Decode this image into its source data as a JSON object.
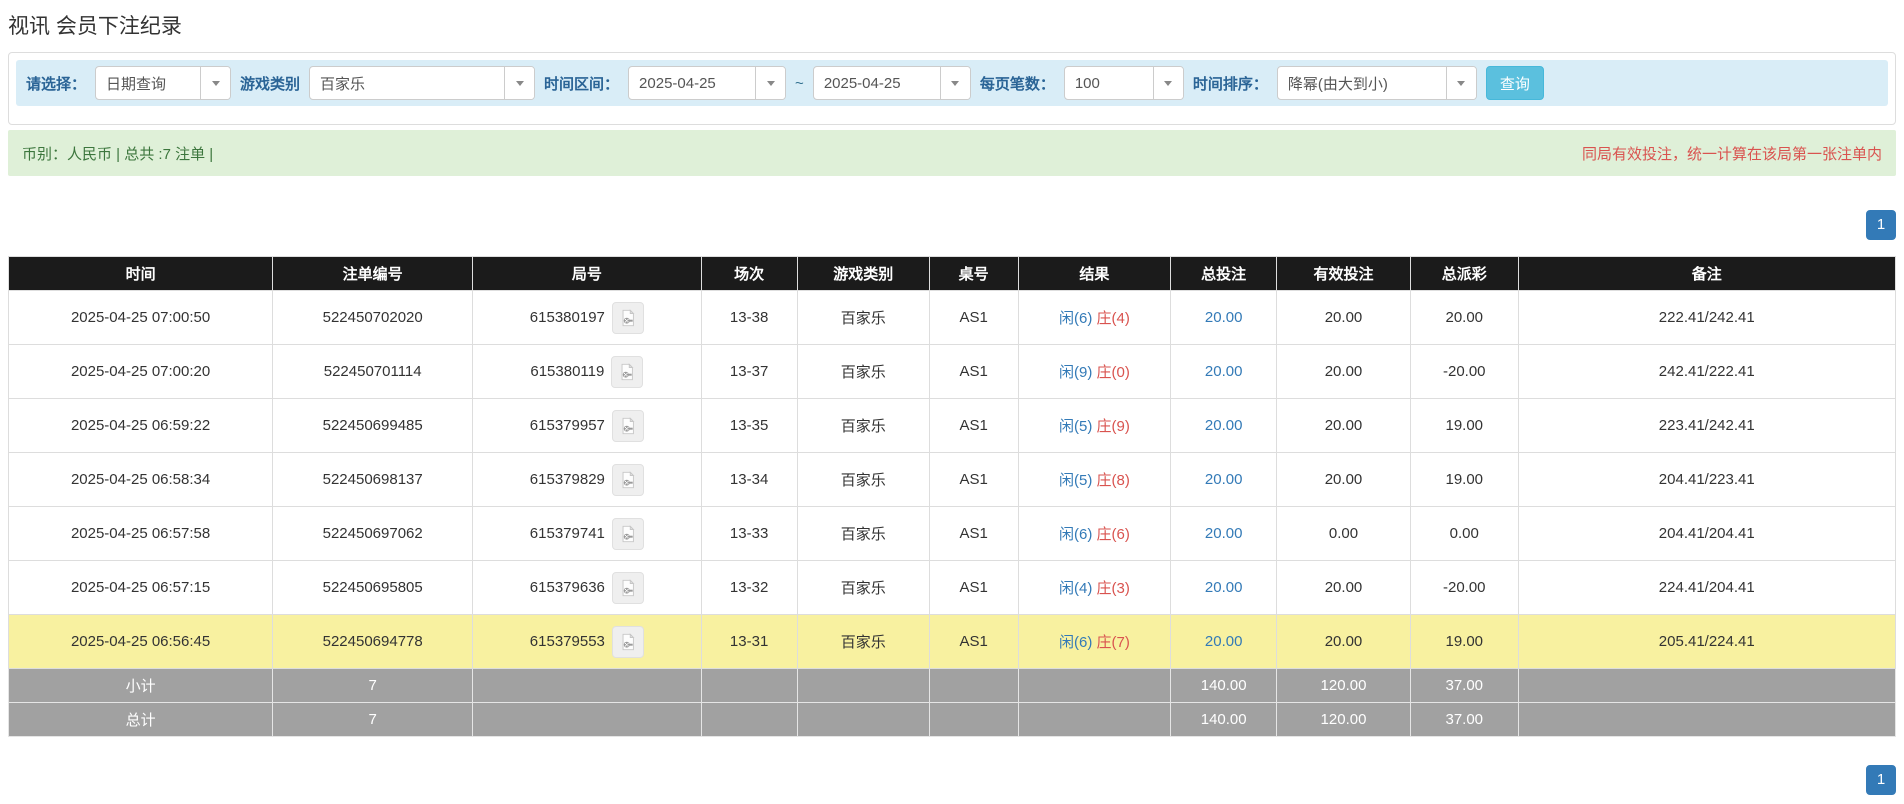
{
  "page_title": "视讯 会员下注纪录",
  "filters": {
    "select_label": "请选择：",
    "select_value": "日期查询",
    "game_type_label": "游戏类别",
    "game_type_value": "百家乐",
    "time_range_label": "时间区间：",
    "date_from": "2025-04-25",
    "tilde": "~",
    "date_to": "2025-04-25",
    "page_size_label": "每页笔数：",
    "page_size_value": "100",
    "sort_label": "时间排序：",
    "sort_value": "降幂(由大到小)",
    "search_button": "查询"
  },
  "summary": {
    "left_text": "币别：人民币 | 总共 :7 注单 |",
    "right_note": "同局有效投注，统一计算在该局第一张注单内"
  },
  "pagination": {
    "page": "1"
  },
  "colors": {
    "accent_blue": "#337ab7",
    "player_blue": "#337ab7",
    "banker_red": "#d9534f",
    "negative_red": "#ff0000",
    "highlight_yellow": "#f8f1a0",
    "filter_bar_bg": "#d9edf7",
    "summary_bar_bg": "#dff0d8",
    "header_bg": "#1b1b1b",
    "totals_bg": "#a1a1a1",
    "search_button_bg": "#5bc0de"
  },
  "table": {
    "headers": [
      "时间",
      "注单编号",
      "局号",
      "场次",
      "游戏类别",
      "桌号",
      "结果",
      "总投注",
      "有效投注",
      "总派彩",
      "备注"
    ],
    "rows": [
      {
        "time": "2025-04-25 07:00:50",
        "bet_id": "522450702020",
        "round_id": "615380197",
        "session": "13-38",
        "game": "百家乐",
        "table_no": "AS1",
        "result_player": "闲(6)",
        "result_banker": "庄(4)",
        "total_bet": "20.00",
        "valid_bet": "20.00",
        "payout": "20.00",
        "payout_negative": false,
        "remark": "222.41/242.41",
        "highlight": false
      },
      {
        "time": "2025-04-25 07:00:20",
        "bet_id": "522450701114",
        "round_id": "615380119",
        "session": "13-37",
        "game": "百家乐",
        "table_no": "AS1",
        "result_player": "闲(9)",
        "result_banker": "庄(0)",
        "total_bet": "20.00",
        "valid_bet": "20.00",
        "payout": "-20.00",
        "payout_negative": true,
        "remark": "242.41/222.41",
        "highlight": false
      },
      {
        "time": "2025-04-25 06:59:22",
        "bet_id": "522450699485",
        "round_id": "615379957",
        "session": "13-35",
        "game": "百家乐",
        "table_no": "AS1",
        "result_player": "闲(5)",
        "result_banker": "庄(9)",
        "total_bet": "20.00",
        "valid_bet": "20.00",
        "payout": "19.00",
        "payout_negative": false,
        "remark": "223.41/242.41",
        "highlight": false
      },
      {
        "time": "2025-04-25 06:58:34",
        "bet_id": "522450698137",
        "round_id": "615379829",
        "session": "13-34",
        "game": "百家乐",
        "table_no": "AS1",
        "result_player": "闲(5)",
        "result_banker": "庄(8)",
        "total_bet": "20.00",
        "valid_bet": "20.00",
        "payout": "19.00",
        "payout_negative": false,
        "remark": "204.41/223.41",
        "highlight": false
      },
      {
        "time": "2025-04-25 06:57:58",
        "bet_id": "522450697062",
        "round_id": "615379741",
        "session": "13-33",
        "game": "百家乐",
        "table_no": "AS1",
        "result_player": "闲(6)",
        "result_banker": "庄(6)",
        "total_bet": "20.00",
        "valid_bet": "0.00",
        "payout": "0.00",
        "payout_negative": false,
        "remark": "204.41/204.41",
        "highlight": false
      },
      {
        "time": "2025-04-25 06:57:15",
        "bet_id": "522450695805",
        "round_id": "615379636",
        "session": "13-32",
        "game": "百家乐",
        "table_no": "AS1",
        "result_player": "闲(4)",
        "result_banker": "庄(3)",
        "total_bet": "20.00",
        "valid_bet": "20.00",
        "payout": "-20.00",
        "payout_negative": true,
        "remark": "224.41/204.41",
        "highlight": false
      },
      {
        "time": "2025-04-25 06:56:45",
        "bet_id": "522450694778",
        "round_id": "615379553",
        "session": "13-31",
        "game": "百家乐",
        "table_no": "AS1",
        "result_player": "闲(6)",
        "result_banker": "庄(7)",
        "total_bet": "20.00",
        "valid_bet": "20.00",
        "payout": "19.00",
        "payout_negative": false,
        "remark": "205.41/224.41",
        "highlight": true
      }
    ],
    "subtotal": {
      "label": "小计",
      "count": "7",
      "total_bet": "140.00",
      "valid_bet": "120.00",
      "payout": "37.00"
    },
    "total": {
      "label": "总计",
      "count": "7",
      "total_bet": "140.00",
      "valid_bet": "120.00",
      "payout": "37.00"
    }
  }
}
